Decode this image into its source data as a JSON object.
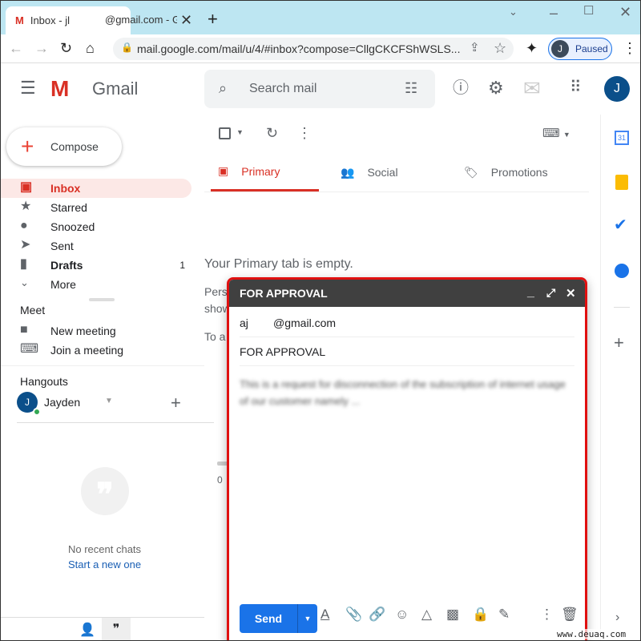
{
  "browser": {
    "tab_title_left": "Inbox - jl",
    "tab_title_right": "@gmail.com - G",
    "url": "mail.google.com/mail/u/4/#inbox?compose=CllgCKCFShWSLS...",
    "profile_initial": "J",
    "profile_status": "Paused"
  },
  "gmail": {
    "logo_text": "Gmail",
    "search_placeholder": "Search mail",
    "avatar_initial": "J",
    "compose_label": "Compose"
  },
  "sidebar": {
    "items": [
      {
        "label": "Inbox",
        "icon": "inbox-icon",
        "active": true
      },
      {
        "label": "Starred",
        "icon": "star-icon"
      },
      {
        "label": "Snoozed",
        "icon": "clock-icon"
      },
      {
        "label": "Sent",
        "icon": "send-icon"
      },
      {
        "label": "Drafts",
        "icon": "draft-icon",
        "count": "1"
      },
      {
        "label": "More",
        "icon": "chevron-down-icon"
      }
    ],
    "meet_title": "Meet",
    "meet_items": [
      "New meeting",
      "Join a meeting"
    ],
    "hangouts_title": "Hangouts",
    "hangouts_user": "Jayden",
    "hangouts_initial": "J",
    "no_chats": "No recent chats",
    "start_new": "Start a new one"
  },
  "main": {
    "tabs": [
      "Primary",
      "Social",
      "Promotions"
    ],
    "empty_title": "Your Primary tab is empty.",
    "fragments": [
      "Pers",
      "show",
      "To a"
    ],
    "storage_fragment": "0"
  },
  "compose": {
    "title": "FOR APPROVAL",
    "to": "aj        @gmail.com",
    "subject": "FOR APPROVAL",
    "body": "This is a request for disconnection of the subscription of internet usage of our customer namely ...",
    "send_label": "Send"
  },
  "watermark": "www.deuaq.com",
  "colors": {
    "accent": "#1a73e8",
    "inbox_red": "#d93025",
    "compose_border": "#e01010"
  }
}
